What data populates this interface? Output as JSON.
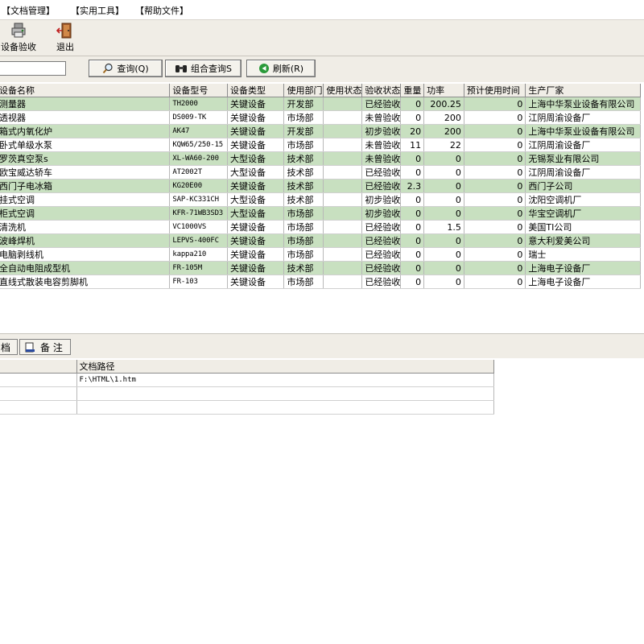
{
  "menu": [
    "【文档管理】",
    "【实用工具】",
    "【帮助文件】"
  ],
  "toolbar": {
    "check_label": "设备验收",
    "exit_label": "退出"
  },
  "search": {
    "value": "",
    "query_label": "查询(Q)",
    "combo_label": "组合查询S",
    "refresh_label": "刷新(R)"
  },
  "grid": {
    "headers": [
      "设备名称",
      "设备型号",
      "设备类型",
      "使用部门",
      "使用状态",
      "验收状态",
      "重量",
      "功率",
      "预计使用时间",
      "生产厂家"
    ],
    "rows": [
      [
        "测量器",
        "TH2000",
        "关键设备",
        "开发部",
        "",
        "已经验收",
        "0",
        "200.25",
        "0",
        "上海中华泵业设备有限公司"
      ],
      [
        "透视器",
        "DS009-TK",
        "关键设备",
        "市场部",
        "",
        "未曾验收",
        "0",
        "200",
        "0",
        "江阴周渝设备厂"
      ],
      [
        "箱式内氧化炉",
        "AK47",
        "关键设备",
        "开发部",
        "",
        "初步验收",
        "20",
        "200",
        "0",
        "上海中华泵业设备有限公司"
      ],
      [
        "卧式单级水泵",
        "KQW65/250-15",
        "关键设备",
        "市场部",
        "",
        "未曾验收",
        "11",
        "22",
        "0",
        "江阴周渝设备厂"
      ],
      [
        "罗茨真空泵s",
        "XL-WA60-200",
        "大型设备",
        "技术部",
        "",
        "未曾验收",
        "0",
        "0",
        "0",
        "无锡泵业有限公司"
      ],
      [
        "欧宝威达轿车",
        "AT2002T",
        "大型设备",
        "技术部",
        "",
        "已经验收",
        "0",
        "0",
        "0",
        "江阴周渝设备厂"
      ],
      [
        "西门子电冰箱",
        "KG20E00",
        "关键设备",
        "技术部",
        "",
        "已经验收",
        "2.3",
        "0",
        "0",
        "西门子公司"
      ],
      [
        "挂式空调",
        "SAP-KC331CH",
        "大型设备",
        "技术部",
        "",
        "初步验收",
        "0",
        "0",
        "0",
        "沈阳空调机厂"
      ],
      [
        "柜式空调",
        "KFR-71WB3SD3",
        "大型设备",
        "市场部",
        "",
        "初步验收",
        "0",
        "0",
        "0",
        "华宝空调机厂"
      ],
      [
        "清洗机",
        "VC1000VS",
        "关键设备",
        "市场部",
        "",
        "已经验收",
        "0",
        "1.5",
        "0",
        "美国TI公司"
      ],
      [
        "波峰焊机",
        "LEPVS-400FC",
        "关键设备",
        "市场部",
        "",
        "已经验收",
        "0",
        "0",
        "0",
        "意大利爱美公司"
      ],
      [
        "电脑剥线机",
        "kappa210",
        "关键设备",
        "市场部",
        "",
        "已经验收",
        "0",
        "0",
        "0",
        "瑞士"
      ],
      [
        "全自动电阻成型机",
        "FR-105M",
        "关键设备",
        "技术部",
        "",
        "已经验收",
        "0",
        "0",
        "0",
        "上海电子设备厂"
      ],
      [
        "直线式散装电容剪脚机",
        "FR-103",
        "关键设备",
        "市场部",
        "",
        "已经验收",
        "0",
        "0",
        "0",
        "上海电子设备厂"
      ]
    ]
  },
  "lower_tabs": {
    "docs_label": "档",
    "notes_label": "备 注"
  },
  "docs": {
    "headers": [
      "",
      "文档路径"
    ],
    "rows": [
      [
        "",
        "F:\\HTML\\1.htm"
      ],
      [
        "",
        ""
      ],
      [
        "",
        ""
      ]
    ]
  },
  "colors": {
    "alt_row": "#c8e0c0",
    "panel": "#f0ede6"
  }
}
